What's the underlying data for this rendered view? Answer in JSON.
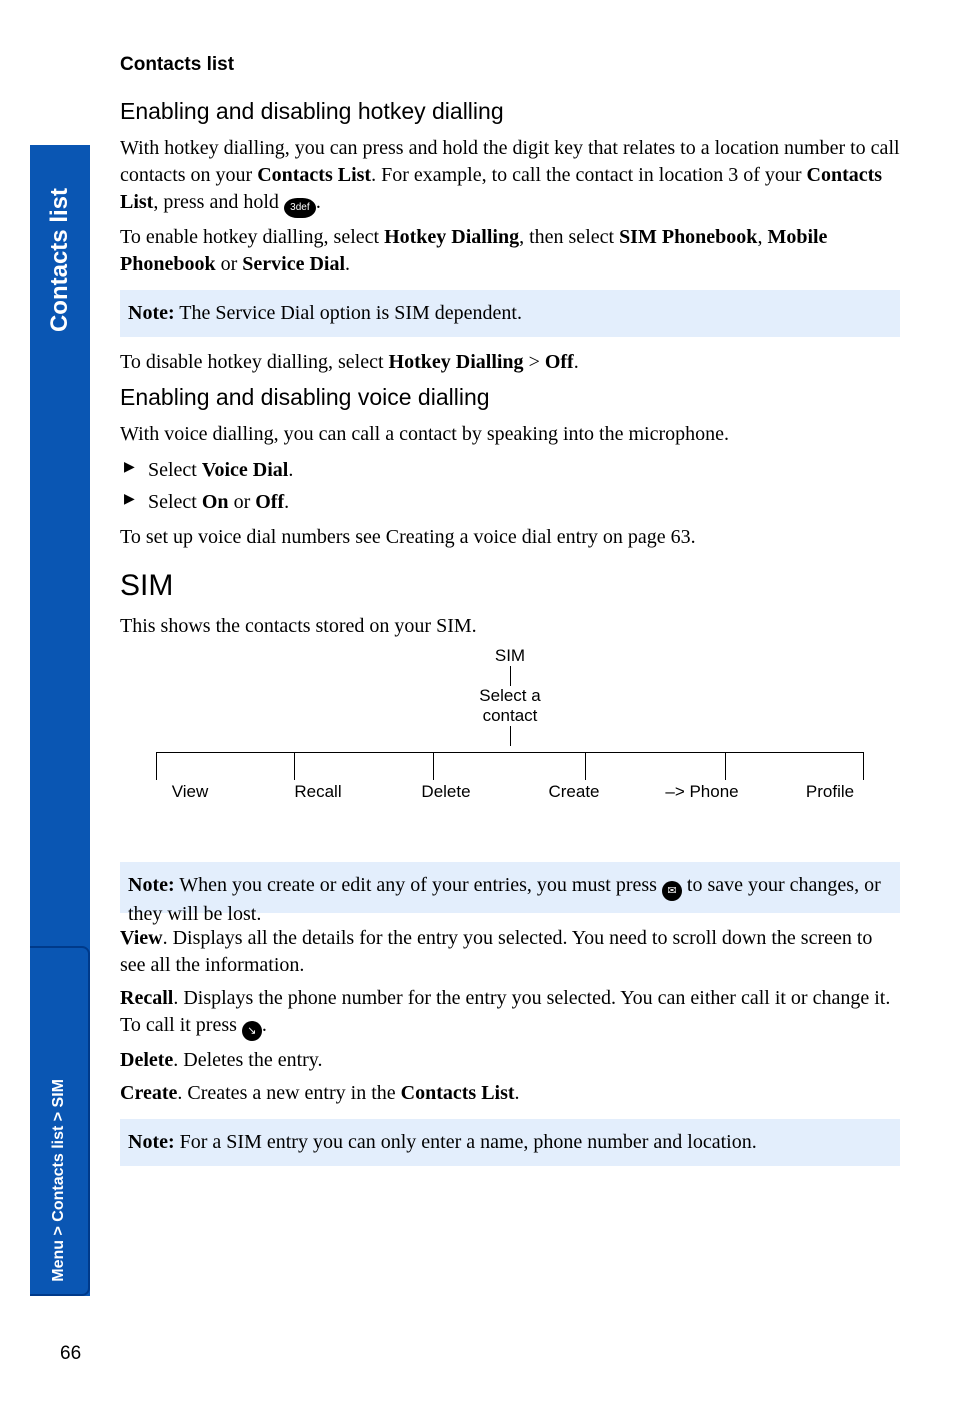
{
  "sidebar": {
    "tab_top": "Contacts list",
    "tab_bottom": "Menu > Contacts list > SIM"
  },
  "page_number": "66",
  "header": "Contacts list",
  "sec1": {
    "title": "Enabling and disabling hotkey dialling",
    "p1a": "With hotkey dialling, you can press and hold the digit key that relates to a location number to call contacts on your ",
    "p1b": "Contacts List",
    "p1c": ". For example, to call the contact in location 3 of your ",
    "p1d": "Contacts List",
    "p1e": ", press and hold ",
    "p1f": ".",
    "key_label": "3def",
    "p2a": "To enable hotkey dialling, select ",
    "p2b": "Hotkey Dialling",
    "p2c": ", then select ",
    "p2d": "SIM Phonebook",
    "p2e": ", ",
    "p2f": "Mobile Phonebook",
    "p2g": " or ",
    "p2h": "Service Dial",
    "p2i": ".",
    "note_label": "Note:",
    "note_body": " The Service Dial option is SIM dependent.",
    "p3a": "To disable hotkey dialling, select ",
    "p3b": "Hotkey Dialling",
    "p3c": " > ",
    "p3d": "Off",
    "p3e": "."
  },
  "sec2": {
    "title": "Enabling and disabling voice dialling",
    "p1": "With voice dialling, you can call a contact by speaking into the microphone.",
    "li1a": "Select ",
    "li1b": "Voice Dial",
    "li1c": ".",
    "li2a": "Select ",
    "li2b": "On",
    "li2c": " or ",
    "li2d": "Off",
    "li2e": ".",
    "p2": "To set up voice dial numbers see Creating a voice dial entry on page 63."
  },
  "sec3": {
    "title": "SIM",
    "p1": "This shows the contacts stored on your SIM.",
    "tree_root": "SIM",
    "tree_mid": "Select a\ncontact",
    "leaves": [
      "View",
      "Recall",
      "Delete",
      "Create",
      "–> Phone",
      "Profile"
    ],
    "note1_label": "Note:",
    "note1_a": " When you create or edit any of your entries, you must press ",
    "note1_icon": "✉",
    "note1_b": " to save your changes, or they will be lost.",
    "view_a": "View",
    "view_b": ". Displays all the details for the entry you selected. You need to scroll down the screen to see all the information.",
    "recall_a": "Recall",
    "recall_b": ". Displays the phone number for the entry you selected. You can either call it or change it. To call it press ",
    "recall_c": ".",
    "dial_icon": "↘",
    "delete_a": "Delete",
    "delete_b": ". Deletes the entry.",
    "create_a": "Create",
    "create_b": ". Creates a new entry in the ",
    "create_c": "Contacts List",
    "create_d": ".",
    "note2_label": "Note:",
    "note2_body": " For a SIM entry you can only enter a name, phone number and location."
  }
}
